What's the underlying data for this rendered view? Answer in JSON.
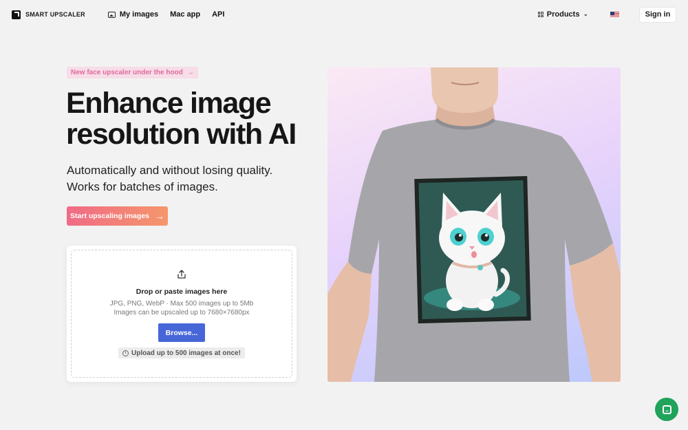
{
  "brand": {
    "name": "SMART UPSCALER"
  },
  "nav": {
    "links": [
      {
        "label": "My images",
        "icon": "image-icon"
      },
      {
        "label": "Mac app"
      },
      {
        "label": "API"
      }
    ],
    "products_label": "Products",
    "language_icon": "us-flag-icon",
    "signin_label": "Sign in"
  },
  "hero": {
    "badge": "New face upscaler under the hood",
    "badge_arrow": "→",
    "headline_line1": "Enhance image",
    "headline_line2": "resolution with AI",
    "sub_line1": "Automatically and without losing quality.",
    "sub_line2": "Works for batches of images.",
    "cta_label": "Start upscaling images",
    "cta_arrow": "→"
  },
  "upload": {
    "title": "Drop or paste images here",
    "formats": "JPG, PNG, WebP · Max 500 images up to 5Mb",
    "max_size": "Images can be upscaled up to 7680×7680px",
    "browse_label": "Browse...",
    "limit_note": "Upload up to 500 images at once!"
  },
  "colors": {
    "accent_blue": "#4767d8",
    "cta_start": "#f06b86",
    "cta_end": "#f5966b",
    "badge_text": "#e06a9c",
    "chat_green": "#20a35b"
  }
}
